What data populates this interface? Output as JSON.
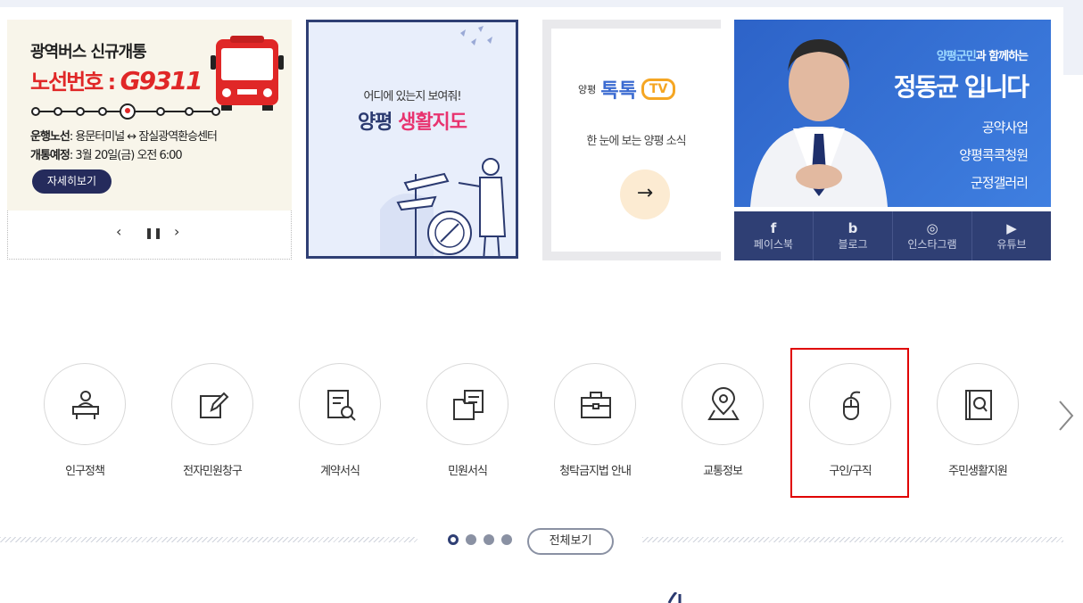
{
  "banners": {
    "bus": {
      "title": "광역버스 신규개통",
      "route_prefix": "노선번호 : ",
      "route_number": "G9311",
      "route_label": "운행노선",
      "route_value": ": 용문터미널 ↔ 잠실광역환승센터",
      "open_label": "개통예정",
      "open_value": ": 3월 20일(금) 오전 6:00",
      "detail_button": "자세히보기"
    },
    "map": {
      "subtitle": "어디에 있는지 보여줘!",
      "title_part1": "양평 ",
      "title_part2": "생활지도"
    },
    "tv": {
      "logo_small": "양평",
      "logo_main": "톡톡",
      "logo_tv": "TV",
      "description": "한 눈에 보는 양평 소식",
      "arrow": "→"
    },
    "governor": {
      "small_hl": "양평군민",
      "small_rest": "과 함께하는",
      "big": "정동균 입니다",
      "links": [
        "공약사업",
        "양평콕콕청원",
        "군정갤러리"
      ]
    }
  },
  "slider_controls": {
    "prev": "‹",
    "pause": "❚❚",
    "next": "›"
  },
  "social": [
    {
      "icon": "f",
      "label": "페이스북"
    },
    {
      "icon": "b",
      "label": "블로그"
    },
    {
      "icon": "◎",
      "label": "인스타그램"
    },
    {
      "icon": "▶",
      "label": "유튜브"
    }
  ],
  "quick_menu": [
    {
      "label": "인구정책",
      "icon": "population-icon"
    },
    {
      "label": "전자민원창구",
      "icon": "edit-icon"
    },
    {
      "label": "계약서식",
      "icon": "document-search-icon"
    },
    {
      "label": "민원서식",
      "icon": "folder-document-icon"
    },
    {
      "label": "청탁금지법 안내",
      "icon": "briefcase-icon"
    },
    {
      "label": "교통정보",
      "icon": "location-pin-icon"
    },
    {
      "label": "구인/구직",
      "icon": "mouse-icon"
    },
    {
      "label": "주민생활지원",
      "icon": "book-search-icon"
    }
  ],
  "pager": {
    "view_all": "전체보기",
    "pages": 4,
    "active_page": 1
  },
  "colors": {
    "navy": "#2f3f74",
    "red": "#e02727",
    "pink": "#e8336f",
    "highlight": "#e00000"
  }
}
